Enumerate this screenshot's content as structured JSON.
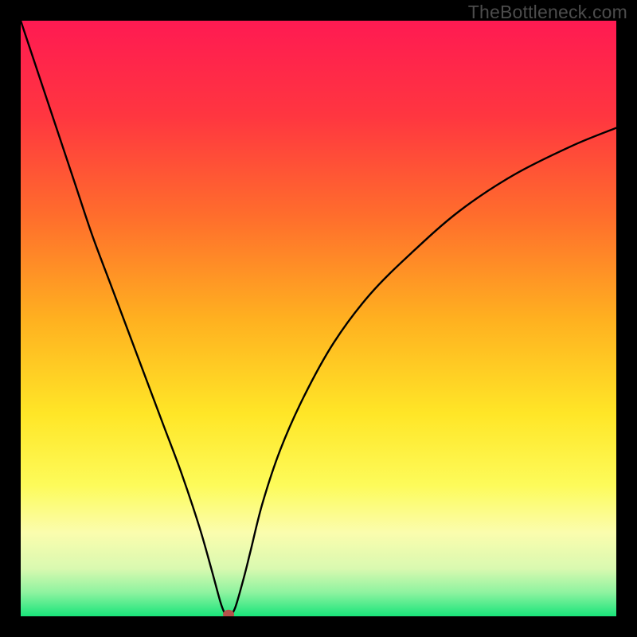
{
  "watermark": "TheBottleneck.com",
  "chart_data": {
    "type": "line",
    "title": "",
    "xlabel": "",
    "ylabel": "",
    "xlim": [
      0,
      100
    ],
    "ylim": [
      0,
      100
    ],
    "grid": false,
    "series": [
      {
        "name": "bottleneck-curve",
        "x": [
          0,
          3,
          6,
          9,
          12,
          15,
          18,
          21,
          24,
          27,
          30,
          32,
          33.5,
          34.2,
          34.6,
          35.2,
          35.6,
          36.2,
          37.6,
          38.6,
          40.6,
          43.6,
          47.6,
          52.6,
          58.6,
          65.6,
          73.6,
          82.6,
          92.6,
          100
        ],
        "y": [
          100,
          91,
          82,
          73,
          64,
          56,
          48,
          40,
          32,
          24,
          15,
          8,
          2.5,
          0.6,
          0,
          0,
          0.6,
          2,
          7,
          11,
          19,
          28,
          37,
          46,
          54,
          61,
          68,
          74,
          79,
          82
        ]
      }
    ],
    "marker": {
      "x": 34.9,
      "y": 0.3,
      "color": "#b6514b"
    },
    "gradient_stops": [
      {
        "offset": 0,
        "color": "#ff1a52"
      },
      {
        "offset": 16,
        "color": "#ff3640"
      },
      {
        "offset": 33,
        "color": "#ff6e2c"
      },
      {
        "offset": 50,
        "color": "#ffb020"
      },
      {
        "offset": 66,
        "color": "#ffe627"
      },
      {
        "offset": 78,
        "color": "#fdfb5a"
      },
      {
        "offset": 86,
        "color": "#fbfdae"
      },
      {
        "offset": 92,
        "color": "#d9f9b0"
      },
      {
        "offset": 96,
        "color": "#8ef3a0"
      },
      {
        "offset": 100,
        "color": "#19e47a"
      }
    ]
  }
}
